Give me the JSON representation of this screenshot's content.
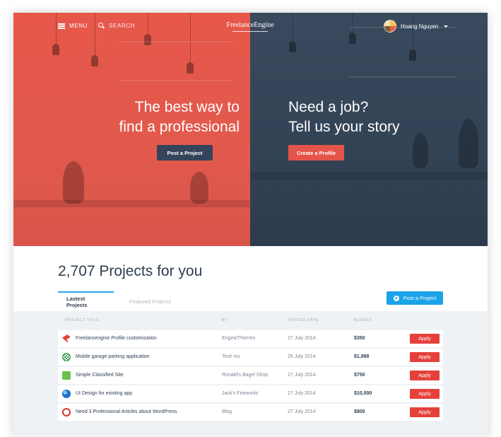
{
  "header": {
    "menu_label": "MENU",
    "search_label": "SEARCH",
    "logo_text": "FreelanceEngine",
    "user_name": "Hoang Nguyen"
  },
  "hero": {
    "left_title_line1": "The best way to",
    "left_title_line2": "find a professional",
    "left_button": "Post a Project",
    "right_title_line1": "Need a job?",
    "right_title_line2": "Tell us your story",
    "right_button": "Create a Profile"
  },
  "projects": {
    "count_heading": "2,707 Projects for you",
    "tabs": [
      {
        "label": "Lastest Projects",
        "active": true
      },
      {
        "label": "Featured Projects",
        "active": false
      }
    ],
    "post_button": "Post a Project",
    "columns": [
      "PROJECT TITLE",
      "BY",
      "POSTED DATE",
      "BUDGET"
    ],
    "rows": [
      {
        "title": "Freelancengine Profile customization",
        "by": "EngineThemes",
        "date": "27 July 2014",
        "budget": "$350",
        "apply": "Apply",
        "icon": "bird-icon",
        "icon_color": "#e5403a"
      },
      {
        "title": "Mobile garage parking application",
        "by": "Tech Inc",
        "date": "25 July 2014",
        "budget": "$1,988",
        "apply": "Apply",
        "icon": "pattern-icon",
        "icon_color": "#3a9a4a"
      },
      {
        "title": "Simple Classified Site",
        "by": "Ronald's Bagel Shop",
        "date": "27 July 2014",
        "budget": "$750",
        "apply": "Apply",
        "icon": "leaf-icon",
        "icon_color": "#6bbf4a"
      },
      {
        "title": "UI Design for existing app",
        "by": "Jack's Fireworks",
        "date": "27 July 2014",
        "budget": "$10,000",
        "apply": "Apply",
        "icon": "globe-icon",
        "icon_color": "#1f6fc4"
      },
      {
        "title": "Need 3 Professional Articles about WordPress",
        "by": "Blog",
        "date": "27 July 2014",
        "budget": "$800",
        "apply": "Apply",
        "icon": "flame-icon",
        "icon_color": "#d9342b"
      }
    ]
  },
  "colors": {
    "hero_left": "#e6574a",
    "hero_right": "#34445a",
    "accent_blue": "#1aa3e8",
    "apply_red": "#e5403a"
  }
}
